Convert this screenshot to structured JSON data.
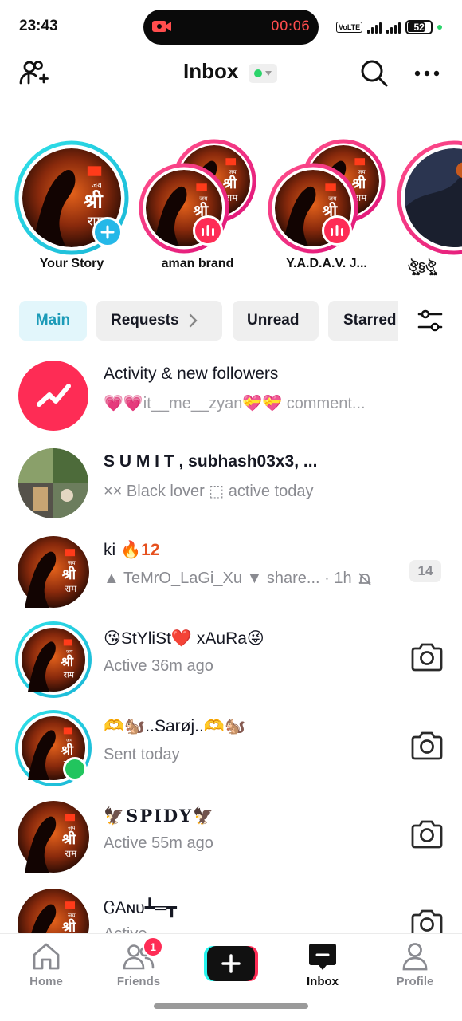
{
  "status_bar": {
    "time": "23:43",
    "recording_time": "00:06",
    "network_label": "VoLTE",
    "battery": "52"
  },
  "header": {
    "title": "Inbox",
    "online_color": "#2bd46b"
  },
  "stories": [
    {
      "label": "Your Story",
      "ring": "teal",
      "badge": "add"
    },
    {
      "label": "aman  brand",
      "ring": "pink",
      "badge": "live"
    },
    {
      "label": "Y.A.D.A.V. J...",
      "ring": "pink",
      "badge": "live"
    },
    {
      "label": "ঔৣ§ঔৣ",
      "ring": "pink",
      "badge": "none"
    }
  ],
  "tabs": [
    {
      "label": "Main"
    },
    {
      "label": "Requests"
    },
    {
      "label": "Unread"
    },
    {
      "label": "Starred"
    }
  ],
  "rows": [
    {
      "name": "Activity & new followers",
      "subtitle": "💗💗it__me__zyan💝💝 comment..."
    },
    {
      "name": "S U M I T , subhash03x3, ...",
      "subtitle": "×× Black lover ⬚ active today"
    },
    {
      "name": "ki 🔥",
      "streak": "12",
      "subtitle": "▲ TeMrO_LaGi_Xu ▼ share... · 1h",
      "count": "14"
    },
    {
      "name": "😘StYliSt❤️ xAuRa😜",
      "subtitle": "Active 36m ago"
    },
    {
      "name": "🫶🐿️..Sarøj..🫶🐿️",
      "subtitle": "Sent today"
    },
    {
      "name": "🦅SPIDY🦅",
      "subtitle": "Active 55m ago"
    },
    {
      "name": "ᏣАɴᴜ┻═┳",
      "subtitle": "Active..."
    }
  ],
  "nav": {
    "home": "Home",
    "friends": "Friends",
    "friends_badge": "1",
    "inbox": "Inbox",
    "profile": "Profile"
  },
  "colors": {
    "accent_pink": "#fe2c55",
    "accent_teal": "#25d0e8",
    "tab_active_text": "#1c9bb8"
  }
}
